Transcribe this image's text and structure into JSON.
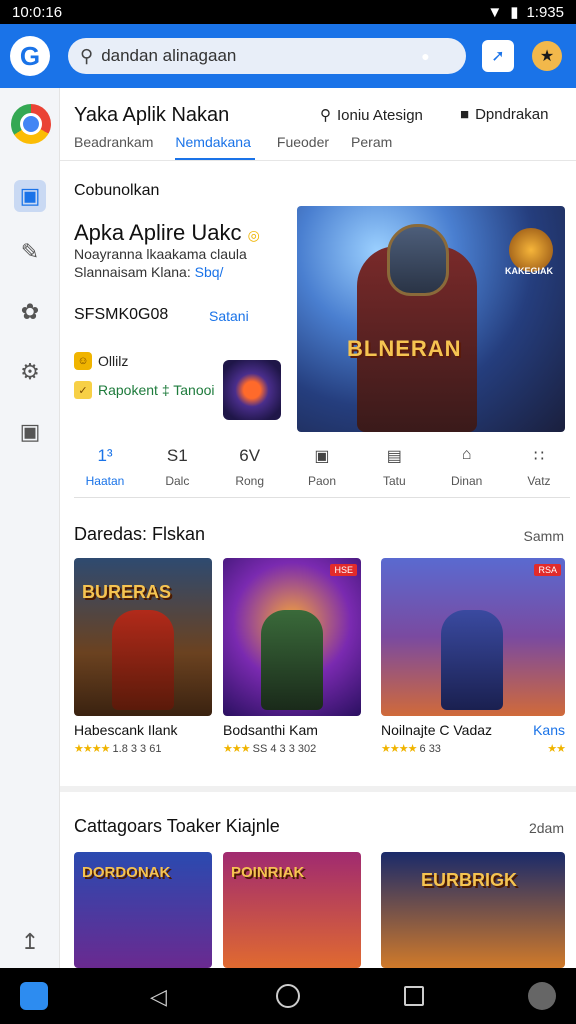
{
  "status": {
    "time_left": "10:0:16",
    "time_right": "1:935"
  },
  "appbar": {
    "logo": "G",
    "search_value": "dandan alinagaan",
    "search_icon": "search-icon"
  },
  "header": {
    "title": "Yaka Aplik Nakan",
    "action1": "Ioniu Atesign",
    "action2": "Dpndrakan",
    "tabs": [
      "Beadrankam",
      "Nemdakana",
      "Fueoder",
      "Peram"
    ],
    "active_tab": 1
  },
  "featured": {
    "label": "Cobunolkan",
    "title": "Apka Aplire Uakc",
    "desc1": "Noayranna lkaakama claula",
    "desc2_text": "Slannaisam Klana:",
    "desc2_link": "Sbq/",
    "code": "SFSMK0G08",
    "code_link": "Satani",
    "row1": "Ollilz",
    "row2": "Rapokent ‡ Tanooi",
    "hero_text": "BLNERAN",
    "hero_badge_text": "KAKEGIAK"
  },
  "stats": [
    {
      "value": "1³",
      "label": "Haatan",
      "kind": "text",
      "highlight": true
    },
    {
      "value": "S1",
      "label": "Dalc",
      "kind": "text",
      "highlight": false
    },
    {
      "value": "6V",
      "label": "Rong",
      "kind": "text",
      "highlight": false
    },
    {
      "value": "▣",
      "label": "Paon",
      "kind": "icon",
      "highlight": false
    },
    {
      "value": "▤",
      "label": "Tatu",
      "kind": "icon",
      "highlight": false
    },
    {
      "value": "⌂",
      "label": "Dinan",
      "kind": "icon",
      "highlight": false
    },
    {
      "value": "∷",
      "label": "Vatz",
      "kind": "icon",
      "highlight": false
    }
  ],
  "section1": {
    "title": "Daredas: Flskan",
    "more": "Samm",
    "cards": [
      {
        "name": "Habescank Ilank",
        "rating": "1.8 3 3 61",
        "art": "BURERAS",
        "tag": ""
      },
      {
        "name": "Bodsanthi Kam",
        "rating": "SS 4 3 3 302",
        "art": "",
        "tag": "HSE"
      },
      {
        "name": "Noilnajte C Vadaz",
        "rating": "6 33",
        "art": "",
        "tag": "RSA"
      },
      {
        "name": "Kans",
        "rating": "",
        "art": "",
        "tag": ""
      }
    ]
  },
  "section2": {
    "title": "Cattagoars Toaker Kiajnle",
    "more": "2dam",
    "cards": [
      {
        "art": "DORDONAK"
      },
      {
        "art": "POINRIAK"
      },
      {
        "art": "EURBRIGK"
      }
    ]
  },
  "colors": {
    "accent": "#1a73e8",
    "star": "#f0b400"
  }
}
